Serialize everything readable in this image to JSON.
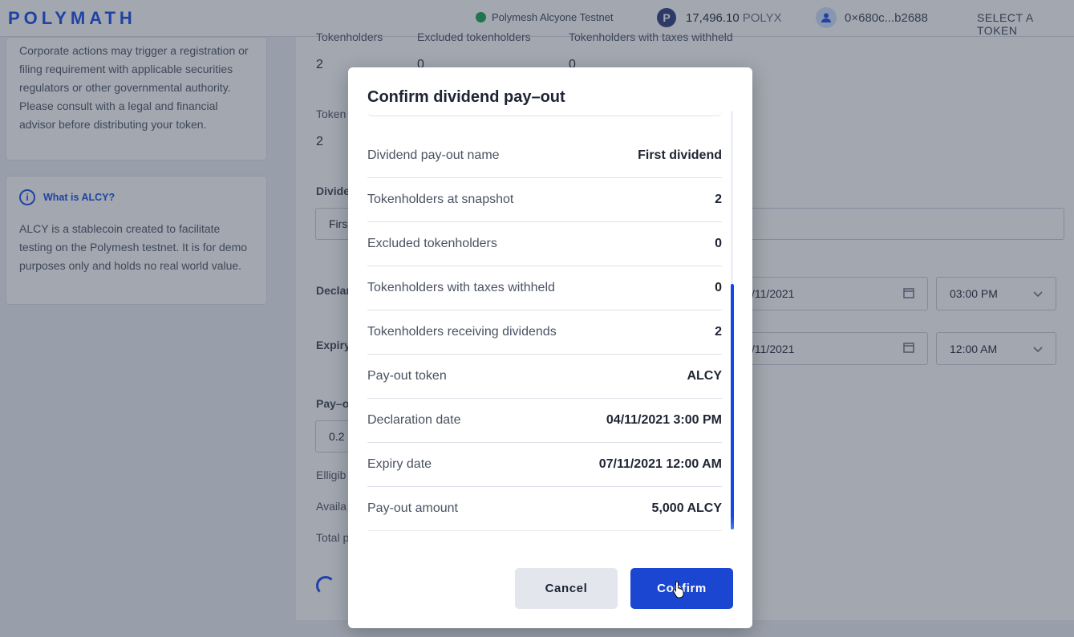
{
  "header": {
    "logo": "POLYMATH",
    "network": "Polymesh Alcyone Testnet",
    "balance_amount": "17,496.10",
    "balance_unit": "POLYX",
    "polyx_icon_letter": "P",
    "account": "0×680c...b2688",
    "select_token": "SELECT A TOKEN"
  },
  "left_cards": {
    "disclaimer_text": "Corporate actions may trigger a registration or filing requirement with applicable securities regulators or other governmental authority. Please consult with a legal and financial advisor before distributing your token.",
    "alcy_title": "What is ALCY?",
    "alcy_text": "ALCY is a stablecoin created to facilitate testing on the Polymesh testnet. It is for demo purposes only and holds no real world value."
  },
  "background_form": {
    "col1_label": "Tokenholders",
    "col2_label": "Excluded tokenholders",
    "col3_label": "Tokenholders with taxes withheld",
    "col1_value": "2",
    "col2_value": "0",
    "col3_value": "0",
    "token_label": "Token",
    "token_value": "2",
    "dividend_label": "Divide",
    "dividend_input": "Firs",
    "declaration_label": "Declar",
    "declaration_date": "/11/2021",
    "declaration_time": "03:00 PM",
    "expiry_label": "Expiry",
    "expiry_date": "/11/2021",
    "expiry_time": "12:00 AM",
    "payout_label": "Pay–o",
    "payout_input": "0.2",
    "eligible_label": "Elligib",
    "available_label": "Availa",
    "total_label": "Total p"
  },
  "modal": {
    "title": "Confirm dividend pay–out",
    "rows": [
      {
        "label": "Dividend pay-out name",
        "value": "First dividend"
      },
      {
        "label": "Tokenholders at snapshot",
        "value": "2"
      },
      {
        "label": "Excluded tokenholders",
        "value": "0"
      },
      {
        "label": "Tokenholders with taxes withheld",
        "value": "0"
      },
      {
        "label": "Tokenholders receiving dividends",
        "value": "2"
      },
      {
        "label": "Pay-out token",
        "value": "ALCY"
      },
      {
        "label": "Declaration date",
        "value": "04/11/2021 3:00 PM"
      },
      {
        "label": "Expiry date",
        "value": "07/11/2021 12:00 AM"
      },
      {
        "label": "Pay-out amount",
        "value": "5,000 ALCY"
      }
    ],
    "cancel_label": "Cancel",
    "confirm_label": "Confirm"
  },
  "colors": {
    "accent": "#1348e8",
    "confirm_button": "#1a46d1",
    "network_status": "#14a44d"
  }
}
